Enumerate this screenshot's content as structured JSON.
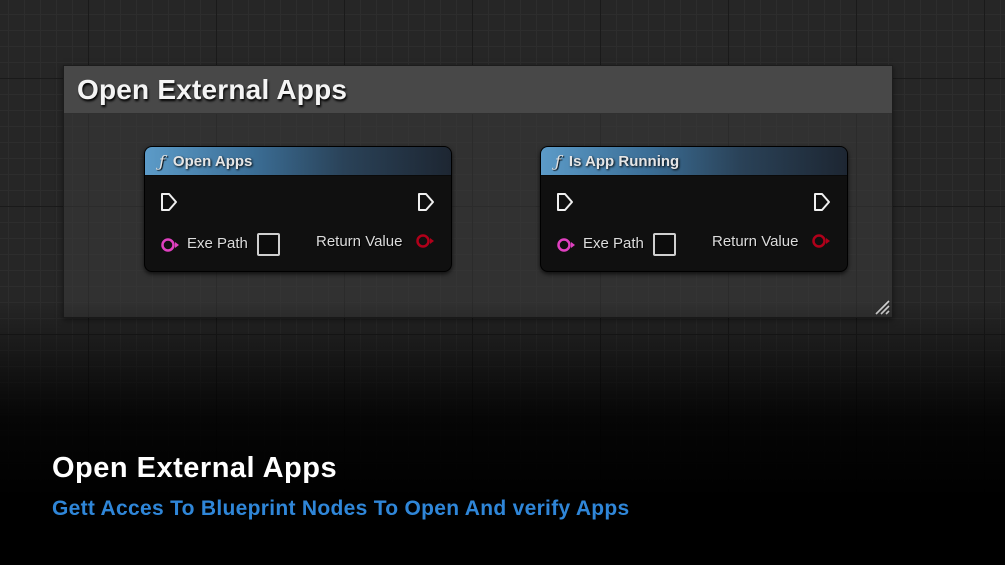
{
  "comment": {
    "title": "Open External Apps"
  },
  "nodes": [
    {
      "icon": "function-icon",
      "icon_glyph": "ƒ",
      "title": "Open Apps",
      "input_pin_label": "Exe Path",
      "output_pin_label": "Return Value"
    },
    {
      "icon": "function-icon",
      "icon_glyph": "ƒ",
      "title": "Is App Running",
      "input_pin_label": "Exe Path",
      "output_pin_label": "Return Value"
    }
  ],
  "caption": {
    "title": "Open External Apps",
    "subtitle": "Gett Acces To Blueprint Nodes To Open And verify Apps"
  },
  "colors": {
    "string_pin": "#e040c0",
    "bool_pin": "#a00014",
    "caption_subtitle": "#2f86d8"
  }
}
